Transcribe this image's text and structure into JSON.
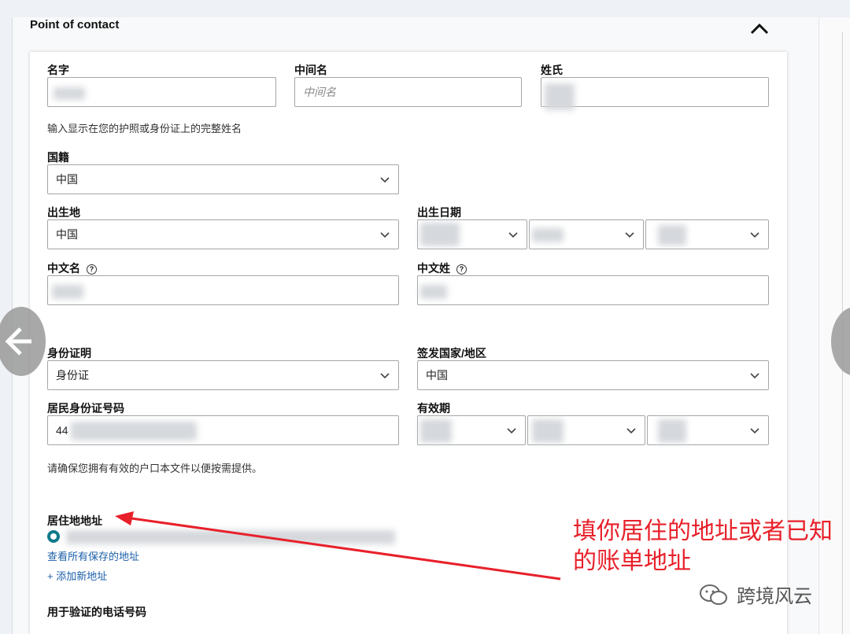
{
  "section": {
    "title": "Point of contact"
  },
  "name_row": {
    "first_label": "名字",
    "first_value": "",
    "middle_label": "中间名",
    "middle_placeholder": "中间名",
    "last_label": "姓氏",
    "last_value": "",
    "hint": "输入显示在您的护照或身份证上的完整姓名"
  },
  "nationality": {
    "label": "国籍",
    "value": "中国"
  },
  "birthplace": {
    "label": "出生地",
    "value": "中国"
  },
  "birthdate": {
    "label": "出生日期"
  },
  "chinese_given_name": {
    "label": "中文名"
  },
  "chinese_surname": {
    "label": "中文姓"
  },
  "id_proof": {
    "label": "身份证明",
    "value": "身份证"
  },
  "issuing_country": {
    "label": "签发国家/地区",
    "value": "中国"
  },
  "id_number": {
    "label": "居民身份证号码",
    "value": "44"
  },
  "expiry": {
    "label": "有效期"
  },
  "hukou_hint": "请确保您拥有有效的户口本文件以便按需提供。",
  "residential_address": {
    "label": "居住地地址",
    "view_saved_link": "查看所有保存的地址",
    "add_new_link": "+ 添加新地址"
  },
  "phone_verification": {
    "label": "用于验证的电话号码"
  },
  "annotation": {
    "line1": "填你居住的地址或者已知",
    "line2": "的账单地址",
    "color": "#e8202a"
  },
  "watermark": {
    "text": "跨境风云"
  },
  "colors": {
    "link": "#1a5fa8",
    "radio": "#0e7a8a",
    "field_border": "#a6a6a6"
  }
}
